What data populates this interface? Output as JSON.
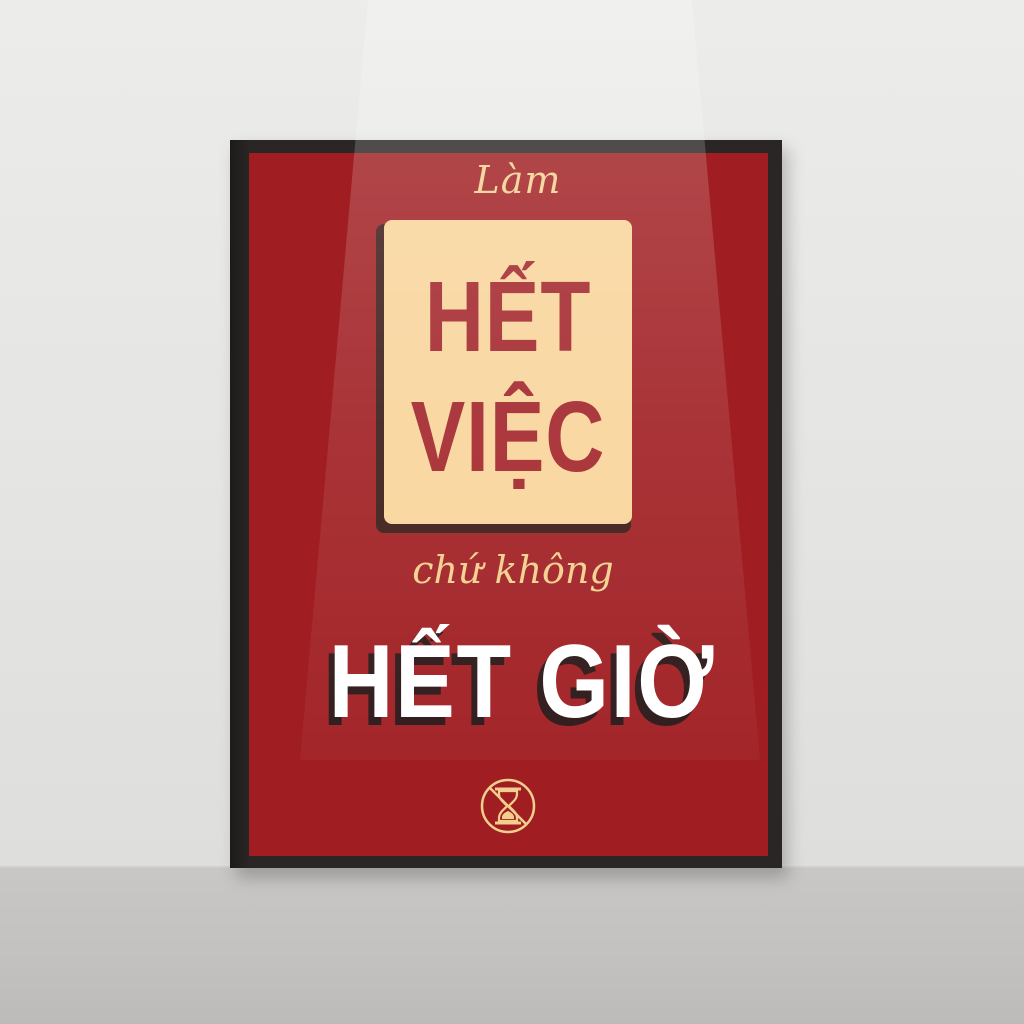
{
  "poster": {
    "line1": "Làm",
    "line2": "HẾT",
    "line3": "VIỆC",
    "line4": "chứ không",
    "line5": "HẾT GIỜ",
    "icon": "no-hourglass-icon"
  },
  "colors": {
    "poster_red": "#a01e22",
    "cream": "#f8d49a",
    "gold_script": "#f2cf8e",
    "frame": "#2a2626"
  }
}
